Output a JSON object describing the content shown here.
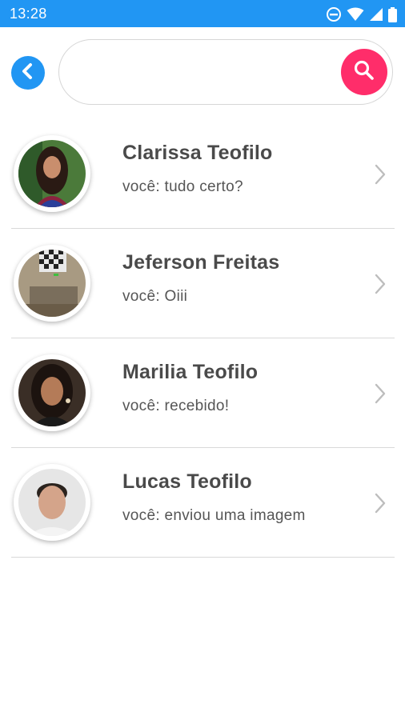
{
  "status_bar": {
    "time": "13:28",
    "icons": [
      "do-not-disturb-icon",
      "wifi-icon",
      "signal-icon",
      "battery-icon"
    ]
  },
  "header": {
    "back_icon": "chevron-left-icon",
    "search_placeholder": "",
    "search_value": "",
    "search_icon": "search-icon"
  },
  "colors": {
    "status_bar": "#2196f3",
    "back_button": "#2196f3",
    "search_button": "#ff2d6a",
    "divider": "#d9d9d9",
    "name_text": "#4a4a4a",
    "preview_text": "#555555"
  },
  "chats": [
    {
      "name": "Clarissa Teofilo",
      "preview": "você: tudo certo?"
    },
    {
      "name": "Jeferson Freitas",
      "preview": "você: Oiii"
    },
    {
      "name": "Marilia Teofilo",
      "preview": "você: recebido!"
    },
    {
      "name": "Lucas Teofilo",
      "preview": "você: enviou uma imagem"
    }
  ]
}
